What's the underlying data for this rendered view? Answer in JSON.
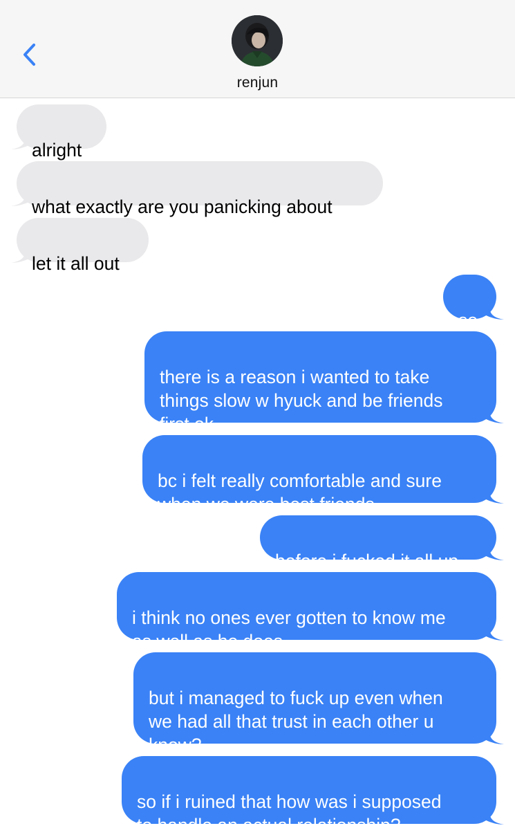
{
  "header": {
    "contact_name": "renjun",
    "back_icon": "chevron-left-icon",
    "accent_color": "#3a82f6"
  },
  "messages": [
    {
      "direction": "incoming",
      "text": "alright"
    },
    {
      "direction": "incoming",
      "text": "what exactly are you panicking about"
    },
    {
      "direction": "incoming",
      "text": "let it all out"
    },
    {
      "direction": "outgoing",
      "text": "so"
    },
    {
      "direction": "outgoing",
      "text": "there is a reason i wanted to take\nthings slow w hyuck and be friends\nfirst ok"
    },
    {
      "direction": "outgoing",
      "text": "bc i felt really comfortable and sure\nwhen we were best friends"
    },
    {
      "direction": "outgoing",
      "text": "before i fucked it all up"
    },
    {
      "direction": "outgoing",
      "text": "i think no ones ever gotten to know me\nas well as he does"
    },
    {
      "direction": "outgoing",
      "text": "but i managed to fuck up even when\nwe had all that trust in each other u\nknow?"
    },
    {
      "direction": "outgoing",
      "text": "so if i ruined that how was i supposed\nto handle an actual relationship?"
    }
  ],
  "colors": {
    "incoming_bubble": "#e9e9eb",
    "outgoing_bubble": "#3a82f6",
    "header_background": "#f6f6f6"
  }
}
